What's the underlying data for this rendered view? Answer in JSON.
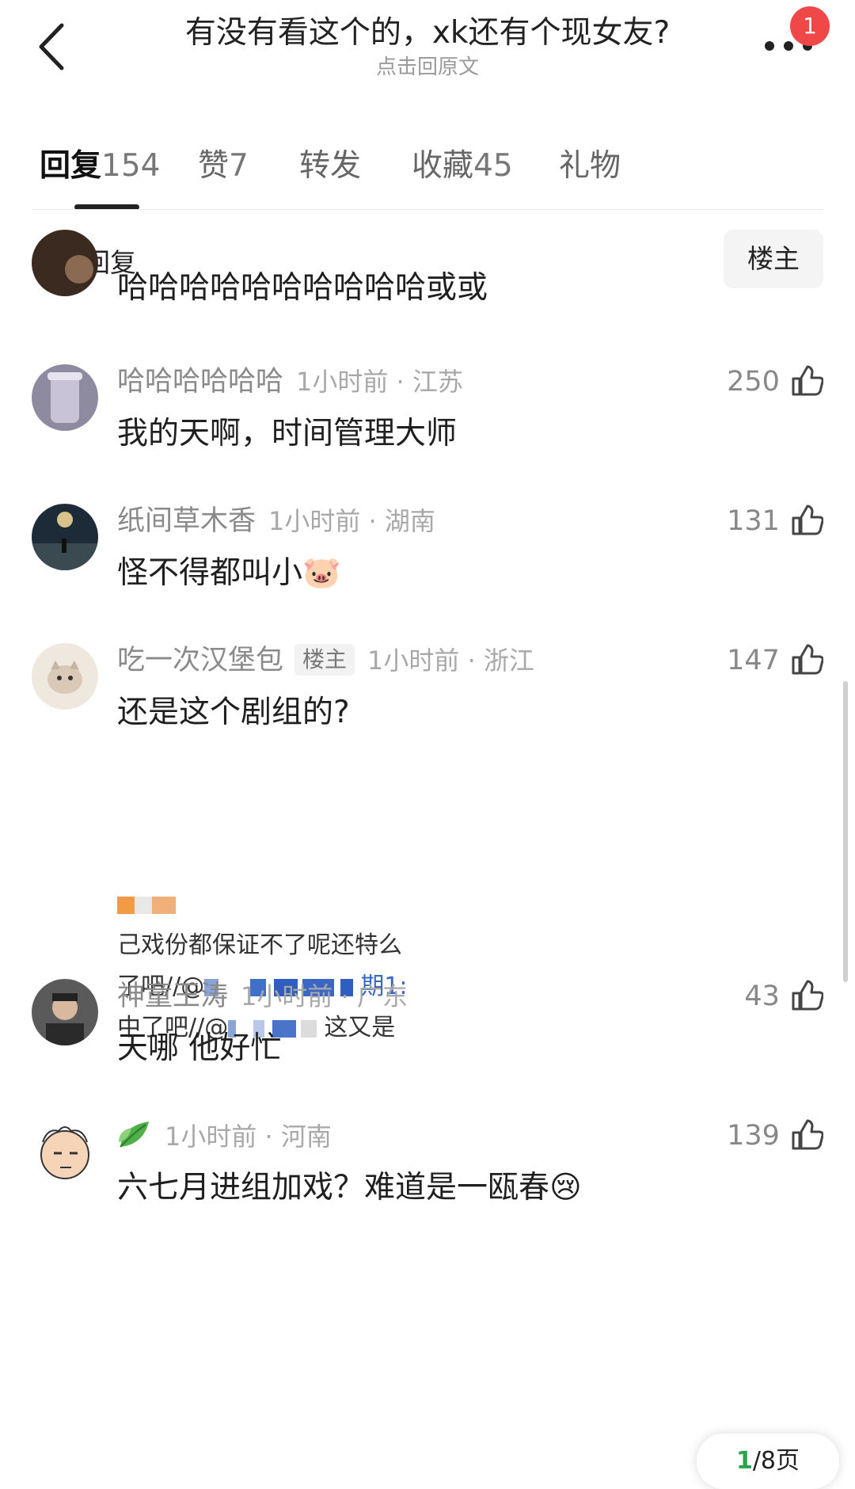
{
  "header": {
    "title": "有没有看这个的，xk还有个现女友?",
    "subtitle": "点击回原文",
    "notification_count": "1"
  },
  "tabs": [
    {
      "label": "回复",
      "count": "154",
      "active": true
    },
    {
      "label": "赞",
      "count": "7"
    },
    {
      "label": "转发",
      "count": ""
    },
    {
      "label": "收藏",
      "count": "45"
    },
    {
      "label": "礼物",
      "count": ""
    }
  ],
  "filter": {
    "label": "全部回复",
    "owner_button": "楼主"
  },
  "comments": [
    {
      "text": "哈哈哈哈哈哈哈哈哈哈或或"
    },
    {
      "username": "哈哈哈哈哈哈",
      "meta": "1小时前 · 江苏",
      "likes": "250",
      "text": "我的天啊，时间管理大师"
    },
    {
      "username": "纸间草木香",
      "meta": "1小时前 · 湖南",
      "likes": "131",
      "text": "怪不得都叫小🐷"
    },
    {
      "username": "吃一次汉堡包",
      "owner_tag": "楼主",
      "meta": "1小时前 · 浙江",
      "likes": "147",
      "text": "还是这个剧组的?"
    },
    {
      "username": "神童王涛",
      "meta": "1小时前 · 广东",
      "likes": "43",
      "text": "天哪 他好忙"
    },
    {
      "username": "",
      "meta": "1小时前 · 河南",
      "likes": "139",
      "text": "六七月进组加戏？难道是一瓯春😢"
    }
  ],
  "embed_image": {
    "lines": [
      "己戏份都保证不了呢还特么",
      "了吧//@",
      "期1:",
      "中了吧//@",
      "这又是"
    ]
  },
  "pagination": {
    "current": "1",
    "rest": "/8页"
  },
  "colors": {
    "badge": "#f04848",
    "pager_accent": "#2aa44f"
  }
}
